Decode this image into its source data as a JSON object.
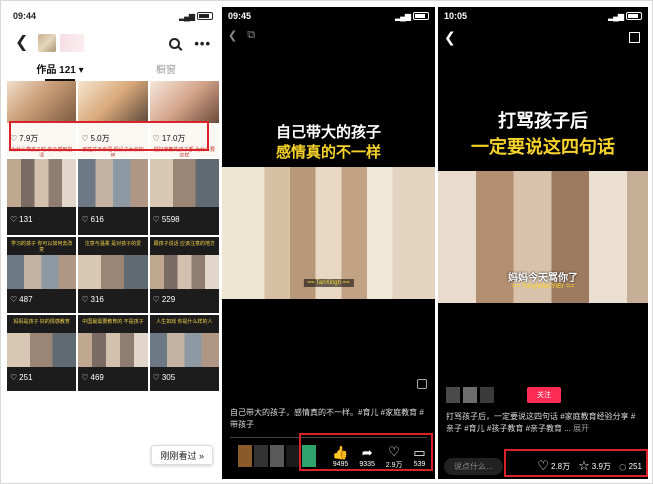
{
  "colors": {
    "highlight": "#d9222a",
    "accent_yellow": "#f5d22c",
    "follow_red": "#fe2c55"
  },
  "phone1": {
    "status": {
      "time": "09:44"
    },
    "header": {
      "back_icon": "chevron-left-icon",
      "search_icon": "search-icon",
      "more_label": "•••"
    },
    "tabs": {
      "works_label": "作品 121 ▾",
      "other_label": "橱窗"
    },
    "grid": [
      {
        "likes": "7.9万",
        "caption": "为什么带孩子时 你会感到崩溃"
      },
      {
        "likes": "5.0万",
        "caption": "家庭并不幸福 假设子女会如何"
      },
      {
        "likes": "17.0万",
        "caption": "挺好家教的孩子都 为什么要这样"
      },
      {
        "likes": "131",
        "caption": ""
      },
      {
        "likes": "616",
        "caption": ""
      },
      {
        "likes": "5598",
        "caption": ""
      },
      {
        "likes": "487",
        "caption": "学习的孩子 你可以如何去改变"
      },
      {
        "likes": "316",
        "caption": "注意与温柔 是对孩子的爱"
      },
      {
        "likes": "229",
        "caption": "跟孩子说话 应该注意的地方"
      },
      {
        "likes": "251",
        "caption": "妈妈是孩子 好的情感教育"
      },
      {
        "likes": "469",
        "caption": "中国最需要教育的 不是孩子"
      },
      {
        "likes": "305",
        "caption": "人生如戏 你是什么样的人"
      }
    ],
    "recent_button": "刚刚看过 »"
  },
  "phone2": {
    "status": {
      "time": "09:45"
    },
    "title_line1": "自己带大的孩子",
    "title_line2": "感情真的不一样",
    "subtitle_name": "== TanXingh ==",
    "caption": "自己带大的孩子，感情真的不一样。#育儿 #家庭教育 #带孩子",
    "actions": [
      {
        "icon": "thumbs-up-icon",
        "glyph": "👍",
        "count": "9495"
      },
      {
        "icon": "share-icon",
        "glyph": "➦",
        "count": "9335"
      },
      {
        "icon": "heart-icon",
        "glyph": "♡",
        "count": "2.9万"
      },
      {
        "icon": "comment-icon",
        "glyph": "▭",
        "count": "539"
      }
    ]
  },
  "phone3": {
    "status": {
      "time": "10:05"
    },
    "title_line1": "打骂孩子后",
    "title_line2": "一定要说这四句话",
    "subtitle_main": "妈妈今天骂你了",
    "subtitle_name": "== TongWanYiEr ==",
    "follow_label": "关注",
    "caption": "打骂孩子后，一定要说这四句话 #家庭教育经验分享 #亲子 #育儿 #孩子教育 #亲子教育 ...",
    "more_label": "展开",
    "comment_placeholder": "说点什么...",
    "actions": [
      {
        "icon": "heart-icon",
        "glyph": "♡",
        "count": "2.8万"
      },
      {
        "icon": "star-icon",
        "glyph": "☆",
        "count": "3.9万"
      },
      {
        "icon": "comment-icon",
        "glyph": "◌",
        "count": "251"
      }
    ]
  }
}
